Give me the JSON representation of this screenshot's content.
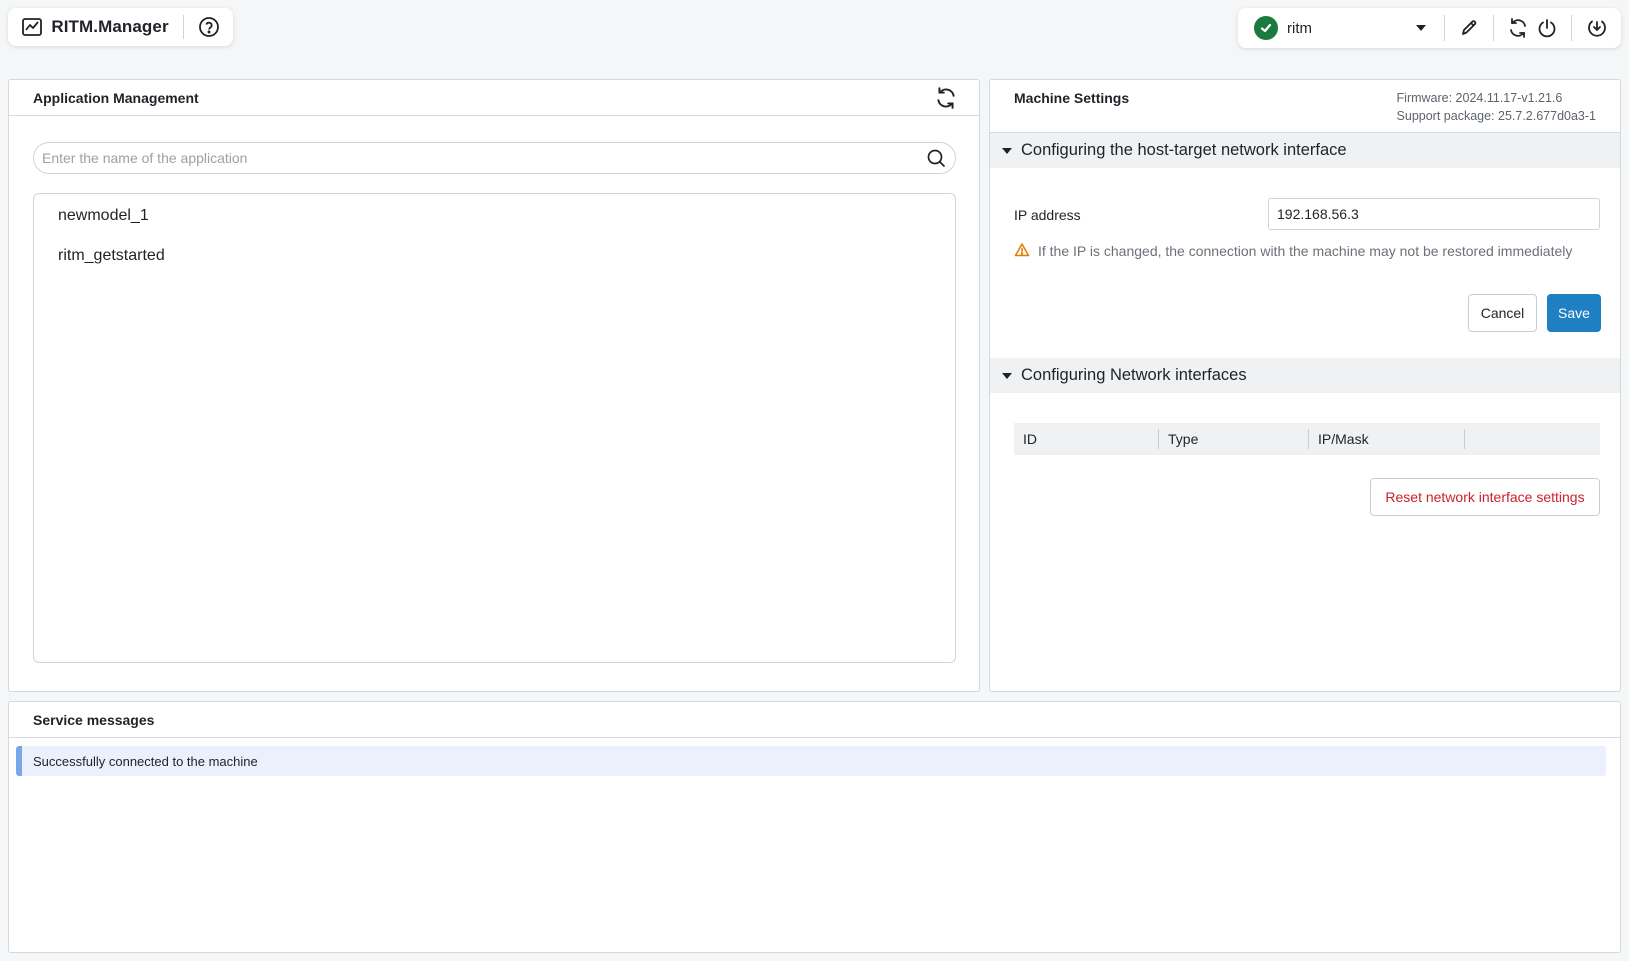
{
  "app": {
    "name": "RITM.Manager"
  },
  "toolbar": {
    "connection_name": "ritm",
    "status_color": "#1b7a3e",
    "icons": [
      "pen-icon",
      "refresh-icon",
      "power-icon",
      "download-icon"
    ]
  },
  "app_management": {
    "title": "Application Management",
    "search_placeholder": "Enter the name of the application",
    "search_value": "",
    "apps": [
      {
        "label": "newmodel_1"
      },
      {
        "label": "ritm_getstarted"
      }
    ]
  },
  "machine_settings": {
    "title": "Machine Settings",
    "firmware": "Firmware: 2024.11.17-v1.21.6",
    "support_package": "Support package: 25.7.2.677d0a3-1",
    "host_target": {
      "title": "Configuring the host-target network interface",
      "ip_label": "IP address",
      "ip_value": "192.168.56.3",
      "warning": "If the IP is changed, the connection with the machine may not be restored immediately",
      "cancel_label": "Cancel",
      "save_label": "Save"
    },
    "network": {
      "title": "Configuring Network interfaces",
      "columns": [
        "ID",
        "Type",
        "IP/Mask"
      ],
      "reset_label": "Reset network interface settings"
    }
  },
  "service_messages": {
    "title": "Service messages",
    "messages": [
      {
        "text": "Successfully connected to the machine"
      }
    ]
  },
  "colors": {
    "accent": "#1e7fc2",
    "danger": "#cc1f2e",
    "warning": "#e07b00",
    "info_bar": "#7aa6e8"
  }
}
